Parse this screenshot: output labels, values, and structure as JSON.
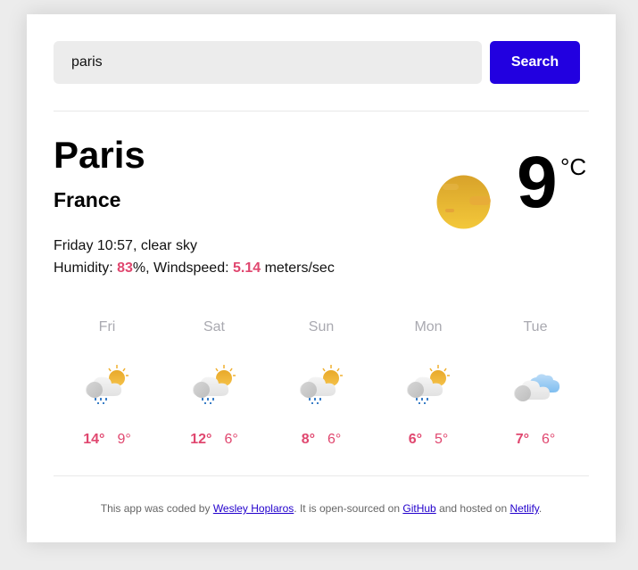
{
  "search": {
    "value": "paris",
    "button_label": "Search"
  },
  "current": {
    "city": "Paris",
    "country": "France",
    "day_time": "Friday 10:57",
    "description": "clear sky",
    "humidity_label": "Humidity: ",
    "humidity": "83",
    "humidity_unit": "%",
    "wind_label": ", Windspeed: ",
    "wind": "5.14",
    "wind_unit": " meters/sec",
    "temperature": "9",
    "unit": "°C",
    "icon": "clear-sky-sun-icon"
  },
  "forecast": [
    {
      "day": "Fri",
      "max": "14°",
      "min": "9°",
      "icon": "sun-cloud-rain-icon"
    },
    {
      "day": "Sat",
      "max": "12°",
      "min": "6°",
      "icon": "sun-cloud-rain-icon"
    },
    {
      "day": "Sun",
      "max": "8°",
      "min": "6°",
      "icon": "sun-cloud-rain-icon"
    },
    {
      "day": "Mon",
      "max": "6°",
      "min": "5°",
      "icon": "sun-cloud-rain-icon"
    },
    {
      "day": "Tue",
      "max": "7°",
      "min": "6°",
      "icon": "clouds-icon"
    }
  ],
  "footer": {
    "text1": "This app was coded by ",
    "author": "Wesley Hoplaros",
    "text2": ". It is open-sourced on ",
    "github": "GitHub",
    "text3": " and hosted on ",
    "netlify": "Netlify",
    "text4": "."
  },
  "colors": {
    "accent": "#2200e0",
    "highlight": "#e0476f"
  }
}
